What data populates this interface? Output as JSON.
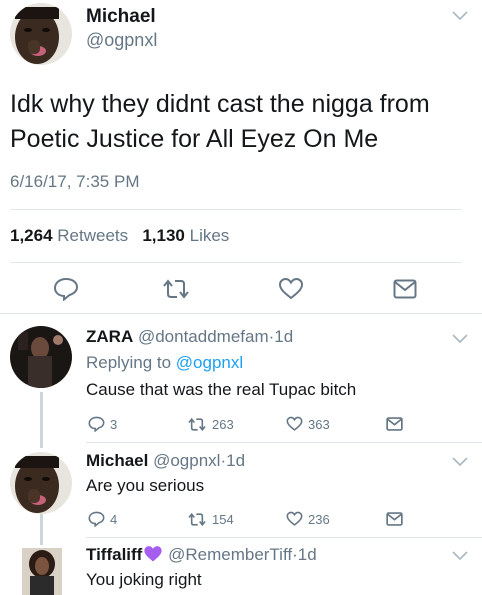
{
  "main_tweet": {
    "author_name": "Michael",
    "author_handle": "@ogpnxl",
    "text_line1": "Idk why they didnt cast the nigga from",
    "text_line2": "Poetic Justice for All Eyez On Me",
    "timestamp": "6/16/17, 7:35 PM",
    "retweets_count": "1,264",
    "retweets_label": "Retweets",
    "likes_count": "1,130",
    "likes_label": "Likes"
  },
  "replies": [
    {
      "author_name": "ZARA",
      "author_handle": "@dontaddmefam",
      "age": "1d",
      "replying_to_label": "Replying to",
      "replying_to_handle": "@ogpnxl",
      "text": "Cause that was the real Tupac bitch",
      "reply_count": "3",
      "retweet_count": "263",
      "like_count": "363"
    },
    {
      "author_name": "Michael",
      "author_handle": "@ogpnxl",
      "age": "1d",
      "text": "Are you serious",
      "reply_count": "4",
      "retweet_count": "154",
      "like_count": "236"
    },
    {
      "author_name": "Tiffaliff",
      "author_handle": "@RememberTiff",
      "age": "1d",
      "text": "You joking right"
    }
  ],
  "separator_dot": "·",
  "icons": [
    "reply-icon",
    "retweet-icon",
    "like-icon",
    "dm-icon",
    "chevron-down-icon",
    "purple-heart-emoji"
  ],
  "colors": {
    "link": "#1da1f2",
    "muted": "#657786",
    "text": "#14171a",
    "heart": "#a55ef0"
  }
}
